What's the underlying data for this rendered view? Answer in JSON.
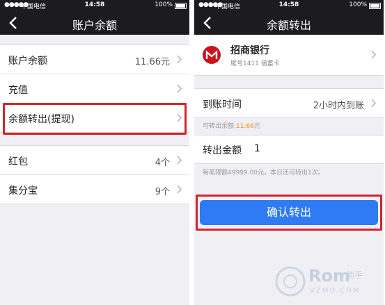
{
  "status": {
    "carrier": "中国电信",
    "time": "14:58",
    "battery": "100%"
  },
  "left": {
    "title": "账户余额",
    "balance_label": "账户余额",
    "balance_value": "11.66元",
    "recharge_label": "充值",
    "withdraw_label": "余额转出(提现)",
    "redpacket_label": "红包",
    "redpacket_value": "4个",
    "jifenbao_label": "集分宝",
    "jifenbao_value": "9个"
  },
  "right": {
    "title": "余额转出",
    "bank_name": "招商银行",
    "bank_card": "尾号1411 储蓄卡",
    "arrival_label": "到账时间",
    "arrival_value": "2小时内到账",
    "available_prefix": "可转出余额:",
    "available_amount": "11.66",
    "available_unit": "元",
    "amount_label": "转出金额",
    "amount_value": "1",
    "limit_note": "每笔限额49999.00元，本日还可转出1次。",
    "confirm_label": "确认转出"
  },
  "watermark": {
    "brand": "Rom",
    "sub": "VZMO.COM",
    "cn": "助手"
  },
  "colors": {
    "accent": "#2e7bf3",
    "highlight": "#d0252f",
    "orange": "#f28a12",
    "nav": "#1c1c1e"
  }
}
